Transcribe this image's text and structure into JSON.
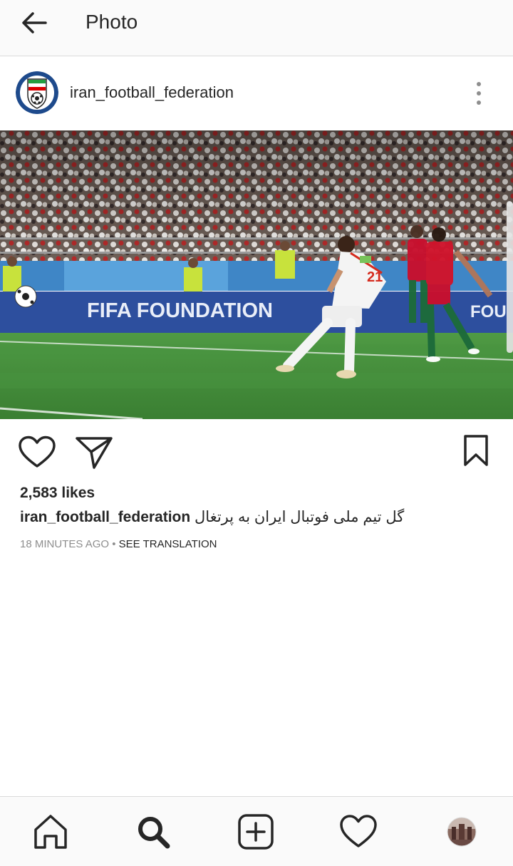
{
  "topbar": {
    "title": "Photo",
    "back_icon": "back-arrow-icon"
  },
  "post": {
    "username": "iran_football_federation",
    "avatar_icon": "federation-logo-icon",
    "more_icon": "more-options-icon",
    "photo": {
      "banner_text": "FIFA FOUNDATION",
      "banner_text_right": "FOU",
      "player_number": "21"
    },
    "actions": {
      "like_icon": "heart-icon",
      "share_icon": "send-icon",
      "save_icon": "bookmark-icon"
    },
    "likes": "2,583 likes",
    "caption_user": "iran_football_federation",
    "caption_text": "گل تیم ملی فوتبال ایران به پرتغال",
    "time": "18 MINUTES AGO",
    "separator": "•",
    "see_translation": "SEE TRANSLATION"
  },
  "bottom_nav": {
    "items": [
      "home-icon",
      "search-icon",
      "add-post-icon",
      "activity-heart-icon",
      "profile-avatar-icon"
    ]
  },
  "colors": {
    "text": "#262626",
    "muted": "#8e8e8e",
    "bar_background": "#fafafa",
    "divider": "#dbdbdb",
    "pitch_green": "#3f8a36",
    "banner_blue": "#2d4f9e"
  }
}
